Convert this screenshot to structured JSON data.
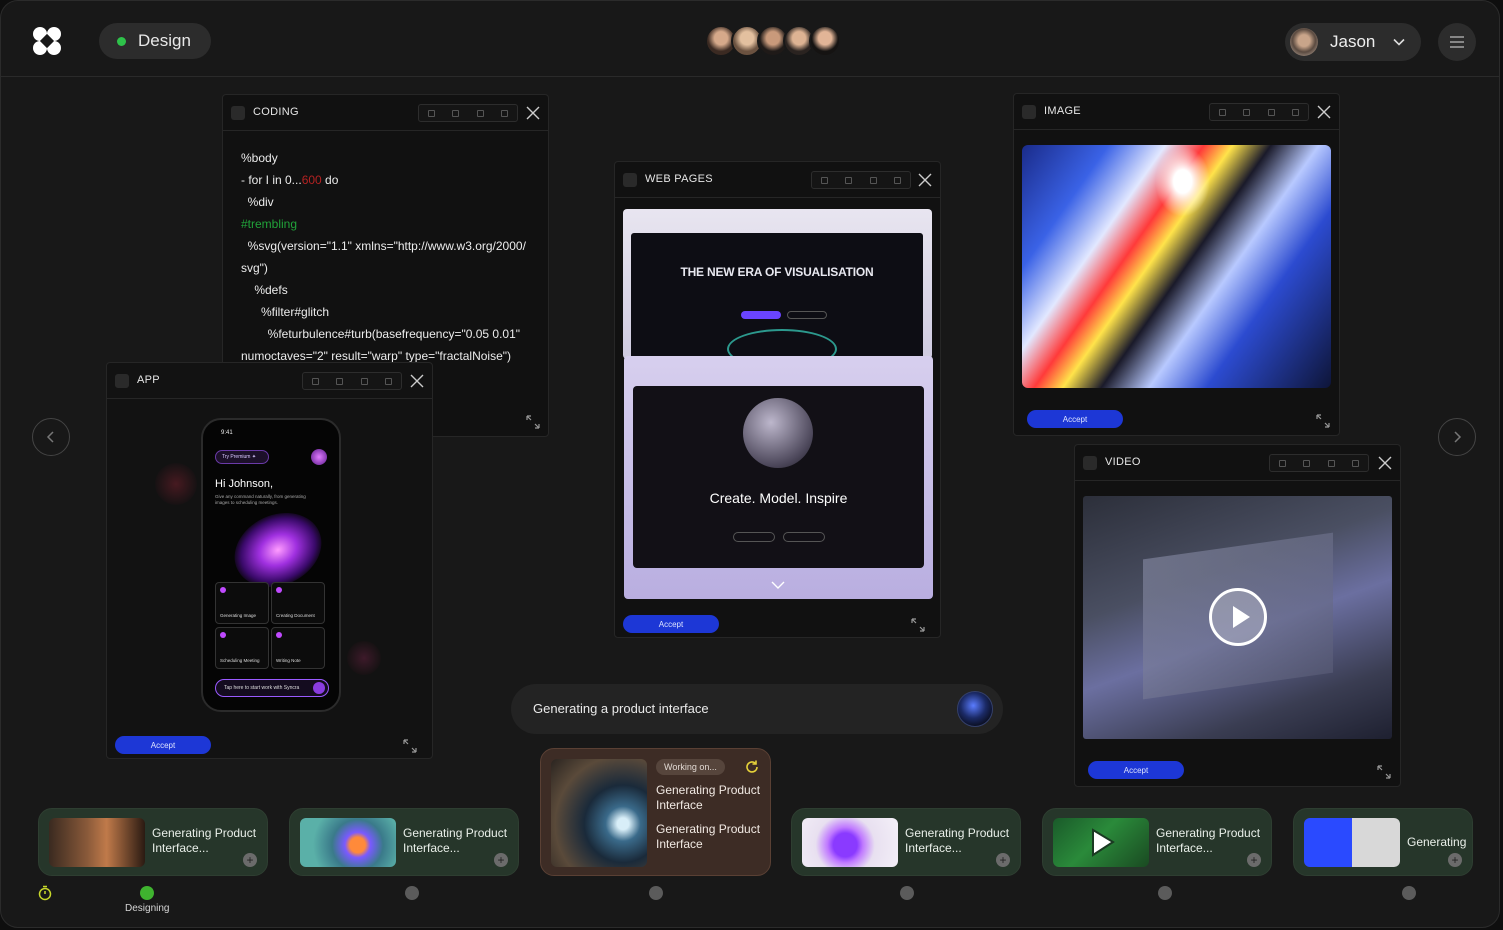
{
  "topbar": {
    "mode_label": "Design",
    "user_name": "Jason",
    "collaborators": [
      "c1",
      "c2",
      "c3",
      "c4",
      "c5"
    ]
  },
  "panels": {
    "coding": {
      "title": "CODING",
      "lines": [
        {
          "parts": [
            {
              "t": "%body"
            }
          ]
        },
        {
          "parts": [
            {
              "t": "- for I in 0..."
            },
            {
              "t": "600",
              "c": "red"
            },
            {
              "t": " do"
            }
          ]
        },
        {
          "parts": [
            {
              "t": "  %div"
            }
          ]
        },
        {
          "parts": [
            {
              "t": "#trembling",
              "c": "green"
            }
          ]
        },
        {
          "parts": [
            {
              "t": "  %svg(version=\"1.1\" xmlns=\"http://www.w3.org/2000/"
            }
          ]
        },
        {
          "parts": [
            {
              "t": "svg\")"
            }
          ]
        },
        {
          "parts": [
            {
              "t": "    %defs"
            }
          ]
        },
        {
          "parts": [
            {
              "t": "      %filter#glitch"
            }
          ]
        },
        {
          "parts": [
            {
              "t": "        %feturbulence#turb(basefrequency=\"0.05 0.01\""
            }
          ]
        },
        {
          "parts": [
            {
              "t": "numoctaves=\"2\" result=\"warp\" type=\"fractalNoise\")"
            }
          ]
        }
      ]
    },
    "web_pages": {
      "title": "WEB PAGES",
      "accept_label": "Accept",
      "preview_headline_1": "THE NEW ERA OF VISUALISATION",
      "preview_headline_2": "Create. Model. Inspire"
    },
    "image": {
      "title": "IMAGE",
      "accept_label": "Accept"
    },
    "video": {
      "title": "VIDEO",
      "accept_label": "Accept"
    },
    "app": {
      "title": "APP",
      "accept_label": "Accept",
      "phone_time": "9:41",
      "phone_greeting": "Hi Johnson,",
      "phone_sub": "Give any command naturally, from generating images to scheduling meetings.",
      "phone_chip": "Try Premium",
      "tiles": [
        "Generating Image",
        "Creating Document",
        "Scheduling Meeting",
        "Writing Note"
      ],
      "phone_input": "Tap here to start work with Syncra"
    }
  },
  "prompt": {
    "text": "Generating a product interface"
  },
  "cards": [
    {
      "text": "Generating Product Interface..."
    },
    {
      "text": "Generating Product Interface..."
    },
    {
      "text": "Generating Product Interface..."
    },
    {
      "text": "Generating Product Interface..."
    },
    {
      "text": "Generating"
    }
  ],
  "active_card": {
    "badge": "Working on...",
    "text_1": "Generating Product Interface",
    "text_2": "Generating Product Interface"
  },
  "timeline": {
    "current_label": "Designing"
  },
  "colors": {
    "accent_blue": "#1d37d6",
    "status_green": "#2ec24a",
    "card_green": "#26362a",
    "card_active": "#3d2c25"
  }
}
